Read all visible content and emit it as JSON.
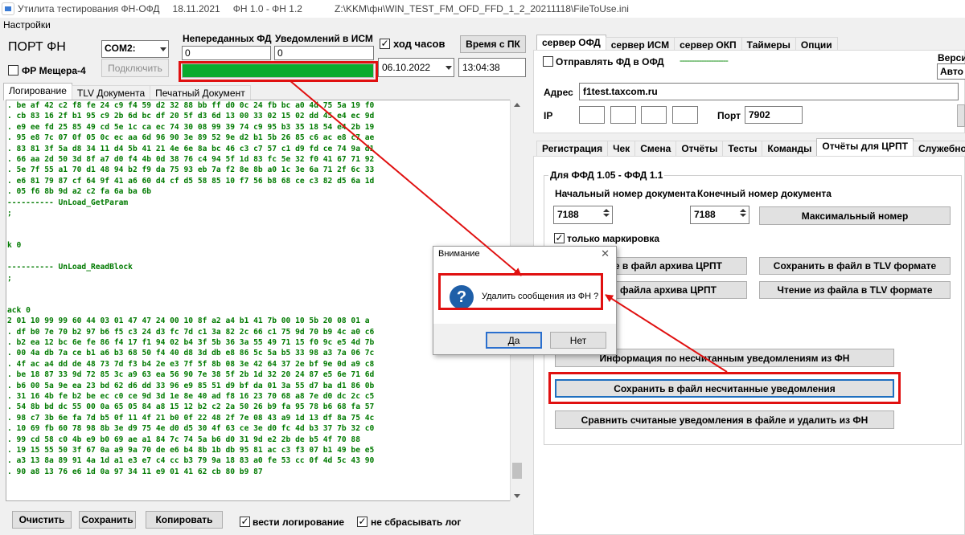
{
  "window": {
    "title": "Утилита тестирования ФН-ОФД",
    "date": "18.11.2021",
    "fn_version": "ФН 1.0 - ФН 1.2",
    "ini_path": "Z:\\KKM\\фн\\WIN_TEST_FM_OFD_FFD_1_2_20211118\\FileToUse.ini"
  },
  "menu": {
    "settings": "Настройки"
  },
  "top": {
    "port_label": "ПОРТ ФН",
    "port_value": "COM2:",
    "fr_label": "ФР Мещера-4",
    "connect_button": "Подключить",
    "unsent_label": "Непереданных ФД",
    "unsent_value": "0",
    "notif_label": "Уведомлений в ИСМ",
    "notif_value": "0",
    "clock_label": "ход часов",
    "pc_time_button": "Время с ПК",
    "date_value": "06.10.2022",
    "time_value": "13:04:38",
    "progress": 1.0
  },
  "left_tabs": [
    "Логирование",
    "TLV Документа",
    "Печатный Документ"
  ],
  "log_lines": [
    ". be af 42 c2 f8 fe 24 c9 f4 59 d2 32 88 bb ff d0 0c 24 fb bc a0 4d 75 5a 19 f0",
    ". cb 83 16 2f b1 95 c9 2b 6d bc df 20 5f d3 6d 13 00 33 02 15 02 dd 45 e4 ec 9d",
    ". e9 ee fd 25 85 49 cd 5e 1c ca ec 74 30 08 99 39 74 c9 95 b3 35 18 54 e4 2b 19",
    ". 95 e8 7c 07 0f 05 0c ec aa 6d 96 90 3e 89 52 9e d2 b1 5b 26 85 c6 ac e8 c7 ae",
    ". 83 81 3f 5a d8 34 11 d4 5b 41 21 4e 6e 8a bc 46 c3 c7 57 c1 d9 fd ce 74 9a d1",
    ". 66 aa 2d 50 3d 8f a7 d0 f4 4b 0d 38 76 c4 94 5f 1d 83 fc 5e 32 f0 41 67 71 92",
    ". 5e 7f 55 a1 70 d1 48 94 b2 f9 da 75 93 eb 7a f2 8e 8b a0 1c 3e 6a 71 2f 6c 33",
    ". e6 81 79 87 cf 64 9f 41 a6 60 d4 cf d5 58 85 10 f7 56 b8 68 ce c3 82 d5 6a 1d",
    ". 05 f6 8b 9d a2 c2 fa 6a ba 6b",
    "---------- UnLoad_GetParam",
    ";",
    "",
    "",
    "k 0",
    "",
    "---------- UnLoad_ReadBlock",
    ";",
    "",
    "",
    "ack 0",
    "2 01 10 99 99 60 44 03 01 47 47 24 00 10 8f a2 a4 b1 41 7b 00 10 5b 20 08 01 a",
    ". df b0 7e 70 b2 97 b6 f5 c3 24 d3 fc 7d c1 3a 82 2c 66 c1 75 9d 70 b9 4c a0 c6",
    ". b2 ea 12 bc 6e fe 86 f4 17 f1 94 02 b4 3f 5b 36 3a 55 49 71 15 f0 9c e5 4d 7b",
    ". 00 4a db 7a ce b1 a6 b3 68 50 f4 40 d8 3d db e8 86 5c 5a b5 33 98 a3 7a 06 7c",
    ". 4f ac a4 dd de 48 73 7d f3 b4 2e e3 7f 5f 8b 08 3e 42 64 37 2e bf 9e 0d a9 c8",
    ". be 18 87 33 9d 72 85 3c a9 63 ea 56 90 7e 38 5f 2b 1d 32 20 24 87 e5 6e 71 6d",
    ". b6 00 5a 9e ea 23 bd 62 d6 dd 33 96 e9 85 51 d9 bf da 01 3a 55 d7 ba d1 86 0b",
    ". 31 16 4b fe b2 be ec c0 ce 9d 3d 1e 8e 40 ad f8 16 23 70 68 a8 7e d0 dc 2c c5",
    ". 54 8b bd dc 55 00 0a 65 05 84 a8 15 12 b2 c2 2a 50 26 b9 fa 95 78 b6 68 fa 57",
    ". 98 c7 3b 6e fa 7d b5 0f 11 4f 21 b0 0f 22 48 2f 7e 08 43 a9 1d 13 df 8a 75 4c",
    ". 10 69 fb 60 78 98 8b 3e d9 75 4e d0 d5 30 4f 63 ce 3e d0 fc 4d b3 37 7b 32 c0",
    ". 99 cd 58 c0 4b e9 b0 69 ae a1 84 7c 74 5a b6 d0 31 9d e2 2b de b5 4f 70 88",
    ". 19 15 55 50 3f 67 0a a9 9a 70 de e6 b4 8b 1b db 95 81 ac c3 f3 07 b1 49 be e5",
    ". a3 13 8a 89 91 4a 1d a1 e3 e7 c4 cc b3 79 9a 18 83 a0 fe 53 cc 0f 4d 5c 43 90",
    ". 90 a8 13 76 e6 1d 0a 97 34 11 e9 01 41 62 cb 80 b9 87"
  ],
  "bottom": {
    "clear_button": "Очистить",
    "save_button": "Сохранить",
    "copy_button": "Копировать",
    "keep_log_label": "вести логирование",
    "no_reset_label": "не сбрасывать лог"
  },
  "right_top_tabs": [
    "сервер ОФД",
    "сервер ИСМ",
    "сервер ОКП",
    "Таймеры",
    "Опции"
  ],
  "ofd": {
    "send_fd_label": "Отправлять ФД в ОФД",
    "status_dashes": "--------------------",
    "version_label": "Верси",
    "version_value": "Авто",
    "address_label": "Адрес",
    "address_value": "f1test.taxcom.ru",
    "ip_label": "IP",
    "port_label": "Порт",
    "port_value": "7902"
  },
  "right_sub_tabs": [
    "Регистрация",
    "Чек",
    "Смена",
    "Отчёты",
    "Тесты",
    "Команды",
    "Отчёты для ЦРПТ",
    "Служебное"
  ],
  "crpt": {
    "group_label": "Для ФФД 1.05 - ФФД 1.1",
    "start_doc_label": "Начальный номер документа",
    "end_doc_label": "Конечный номер документа",
    "start_doc_value": "7188",
    "end_doc_value": "7188",
    "max_number_button": "Максимальный номер",
    "only_marking_label": "только маркировка",
    "save_archive_button": "ие в файл архива ЦРПТ",
    "save_tlv_button": "Сохранить в файл в TLV формате",
    "read_archive_button": "з файла архива ЦРПТ",
    "read_tlv_button": "Чтение из файла в TLV формате",
    "info_unread_button": "Информация по несчитанным уведомлениям из ФН",
    "save_unread_button": "Сохранить в файл несчитанные уведомления",
    "compare_delete_button": "Сравнить считаные уведомления в файле и удалить из ФН"
  },
  "dialog": {
    "title": "Внимание",
    "message": "Удалить сообщения из ФН ?",
    "yes_button": "Да",
    "no_button": "Нет",
    "icon_glyph": "?",
    "close_glyph": "✕"
  },
  "colors": {
    "progress_green": "#0bab2e",
    "highlight_red": "#e01010",
    "log_green": "#007a00",
    "info_blue": "#1f5fa8"
  }
}
